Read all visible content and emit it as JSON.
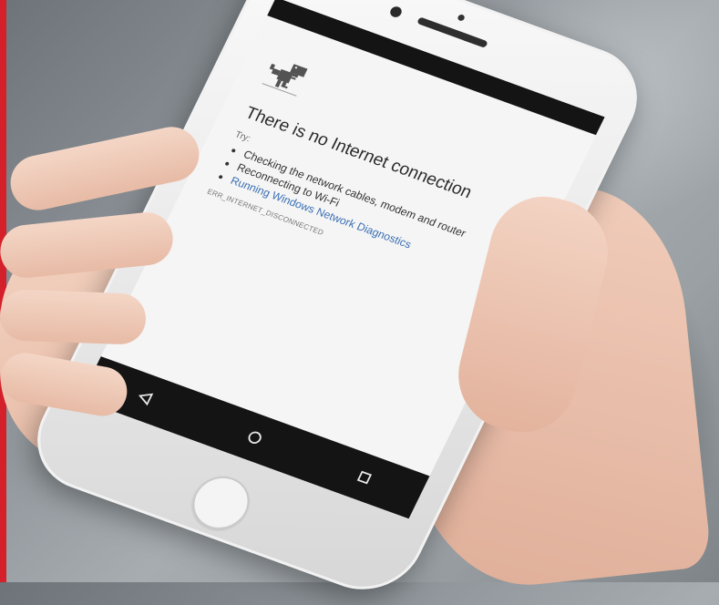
{
  "screen": {
    "title": "There is no Internet connection",
    "try_label": "Try:",
    "tips": [
      "Checking the network cables, modem and router",
      "Reconnecting to Wi-Fi"
    ],
    "link_label": "Running Windows Network Diagnostics",
    "error_code": "ERR_INTERNET_DISCONNECTED"
  },
  "icons": {
    "dino": "dino-icon",
    "back": "back-triangle-icon",
    "home": "home-circle-icon",
    "recents": "recents-square-icon"
  },
  "colors": {
    "link": "#3a6fb3",
    "accent_edge": "#d3202a"
  }
}
